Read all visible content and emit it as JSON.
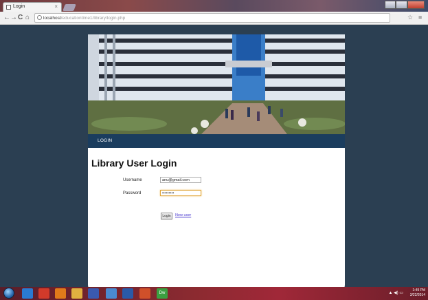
{
  "browser": {
    "tab_title": "Login",
    "tab_close": "×",
    "url_host": "localhost",
    "url_path": "/educationtime1/library/login.php",
    "back_glyph": "←",
    "forward_glyph": "→",
    "reload_glyph": "C",
    "home_glyph": "⌂",
    "star_glyph": "☆",
    "menu_glyph": "≡"
  },
  "site": {
    "nav": {
      "login": "LOGIN"
    },
    "heading": "Library User Login",
    "form": {
      "username_label": "Username",
      "username_value": "anu@gmail.com",
      "password_label": "Password",
      "password_value": "•••••••••",
      "submit_label": "Login",
      "new_user_label": "New user"
    }
  },
  "taskbar": {
    "time": "1:49 PM",
    "date": "3/22/2014",
    "apps": [
      {
        "icon": "internet-explorer-icon",
        "color": "#2a7ad0"
      },
      {
        "icon": "chrome-icon",
        "color": "#d23a2a"
      },
      {
        "icon": "firefox-icon",
        "color": "#e07a1a"
      },
      {
        "icon": "folder-icon",
        "color": "#e0b040"
      },
      {
        "icon": "media-player-icon",
        "color": "#3a5ab0"
      },
      {
        "icon": "network-icon",
        "color": "#4a8ad0"
      },
      {
        "icon": "word-icon",
        "color": "#2a5aa8"
      },
      {
        "icon": "paint-icon",
        "color": "#d0502a"
      },
      {
        "icon": "dreamweaver-icon",
        "color": "#3aa040",
        "label": "Dw"
      }
    ]
  },
  "colors": {
    "page_background": "#2b3f52",
    "nav_bar": "#1b3d5e",
    "link": "#4a3ad0"
  }
}
